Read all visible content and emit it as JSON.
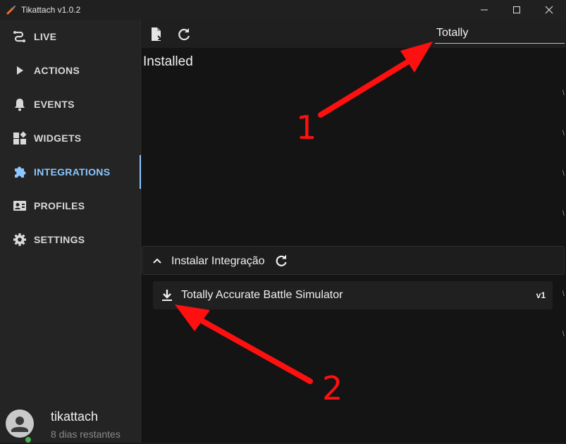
{
  "window": {
    "title": "Tikattach v1.0.2"
  },
  "sidebar": {
    "items": [
      {
        "label": "LIVE",
        "icon": "live-icon"
      },
      {
        "label": "ACTIONS",
        "icon": "play-icon"
      },
      {
        "label": "EVENTS",
        "icon": "bell-icon"
      },
      {
        "label": "WIDGETS",
        "icon": "widgets-icon"
      },
      {
        "label": "INTEGRATIONS",
        "icon": "puzzle-icon",
        "active": true
      },
      {
        "label": "PROFILES",
        "icon": "profile-card-icon"
      },
      {
        "label": "SETTINGS",
        "icon": "gear-icon"
      }
    ],
    "user": {
      "name": "tikattach",
      "subtitle": "8 dias restantes",
      "status_color": "#4caf50"
    }
  },
  "toolbar": {
    "search_value": "Totally"
  },
  "main": {
    "installed_title": "Installed",
    "install_section": {
      "label": "Instalar Integração"
    },
    "integrations": [
      {
        "name": "Totally Accurate Battle Simulator",
        "version": "v1"
      }
    ]
  },
  "annotations": [
    {
      "number": "1"
    },
    {
      "number": "2"
    }
  ],
  "colors": {
    "accent": "#8cc7ff",
    "annotation": "#ff1010"
  }
}
